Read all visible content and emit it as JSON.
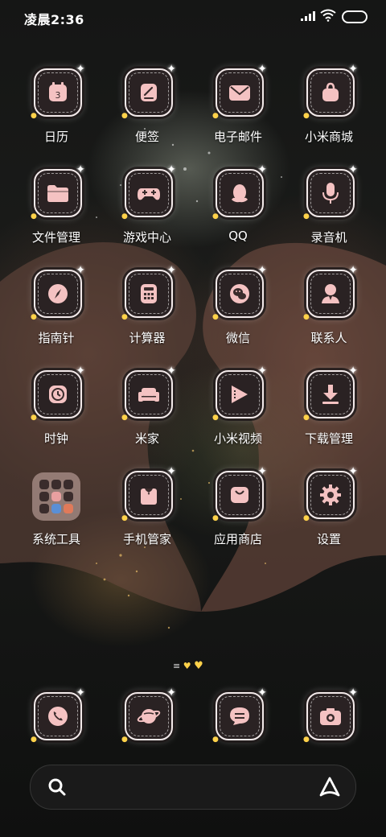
{
  "status_bar": {
    "time": "凌晨2:36"
  },
  "apps": [
    {
      "label": "日历",
      "icon": "calendar-icon"
    },
    {
      "label": "便签",
      "icon": "notes-icon"
    },
    {
      "label": "电子邮件",
      "icon": "email-icon"
    },
    {
      "label": "小米商城",
      "icon": "shopping-bag-icon"
    },
    {
      "label": "文件管理",
      "icon": "folder-icon"
    },
    {
      "label": "游戏中心",
      "icon": "gamepad-icon"
    },
    {
      "label": "QQ",
      "icon": "penguin-icon"
    },
    {
      "label": "录音机",
      "icon": "microphone-icon"
    },
    {
      "label": "指南针",
      "icon": "compass-icon"
    },
    {
      "label": "计算器",
      "icon": "calculator-icon"
    },
    {
      "label": "微信",
      "icon": "chat-bubbles-icon"
    },
    {
      "label": "联系人",
      "icon": "person-icon"
    },
    {
      "label": "时钟",
      "icon": "clock-icon"
    },
    {
      "label": "米家",
      "icon": "sofa-icon"
    },
    {
      "label": "小米视频",
      "icon": "video-play-icon"
    },
    {
      "label": "下载管理",
      "icon": "download-icon"
    },
    {
      "label": "系统工具",
      "icon": "folder-grid-icon"
    },
    {
      "label": "手机管家",
      "icon": "suit-icon"
    },
    {
      "label": "应用商店",
      "icon": "store-bag-icon"
    },
    {
      "label": "设置",
      "icon": "gear-icon"
    }
  ],
  "dock": [
    {
      "icon": "phone-icon"
    },
    {
      "icon": "planet-browser-icon"
    },
    {
      "icon": "message-icon"
    },
    {
      "icon": "camera-icon"
    }
  ],
  "page_indicator": {
    "active_page": 2,
    "pages": 2
  },
  "colors": {
    "icon_fill": "#f4c2c2",
    "tile_bg": "#2a2223",
    "accent": "#ffd24a"
  }
}
